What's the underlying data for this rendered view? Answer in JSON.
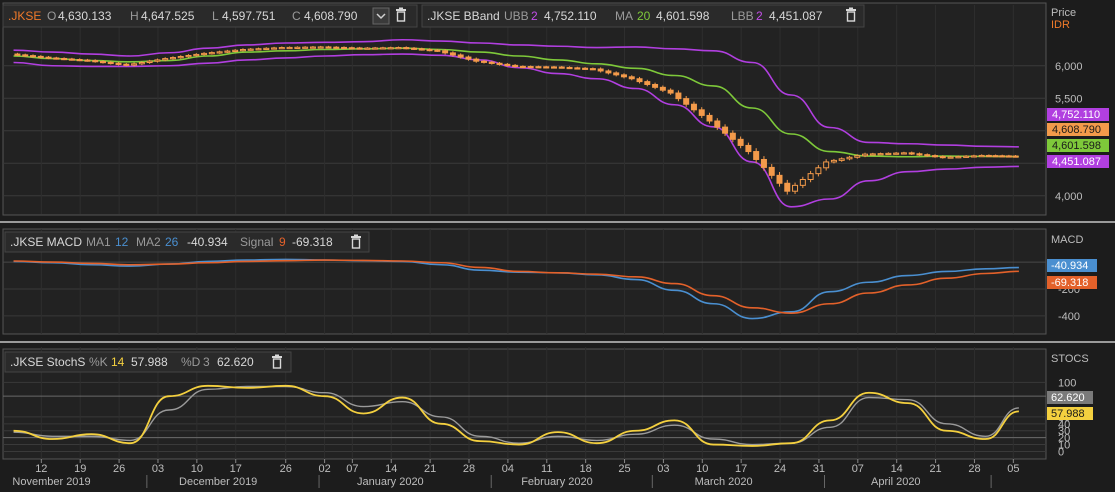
{
  "colors": {
    "background": "#1c1c1c",
    "panel": "#222222",
    "grid": "#3a3a3a",
    "candle": "#f39a4a",
    "bband_outer": "#b13fe0",
    "bband_ma": "#7ec93a",
    "macd_line": "#4a8fd0",
    "signal_line": "#e3612a",
    "stoch_k": "#f4d03f",
    "stoch_d": "#9a9a9a",
    "accent_orange": "#f07a2a"
  },
  "price_panel": {
    "legend": {
      "symbol": ".JKSE",
      "o_label": "O",
      "o_value": "4,630.133",
      "h_label": "H",
      "h_value": "4,647.525",
      "l_label": "L",
      "l_value": "4,597.751",
      "c_label": "C",
      "c_value": "4,608.790",
      "bband_name": ".JKSE BBand",
      "ubb_label": "UBB",
      "ubb_param": "2",
      "ubb_value": "4,752.110",
      "ma_label": "MA",
      "ma_param": "20",
      "ma_value": "4,601.598",
      "lbb_label": "LBB",
      "lbb_param": "2",
      "lbb_value": "4,451.087",
      "dropdown_icon": "chevron-down-icon",
      "delete_icon": "trash-icon"
    },
    "axis_title": "Price",
    "axis_unit": "IDR",
    "tags": {
      "ubb": "4,752.110",
      "close": "4,608.790",
      "ma": "4,601.598",
      "lbb": "4,451.087"
    }
  },
  "macd_panel": {
    "legend": {
      "name": ".JKSE MACD",
      "ma1_label": "MA1",
      "ma1_param": "12",
      "ma2_label": "MA2",
      "ma2_param": "26",
      "macd_value": "-40.934",
      "signal_label": "Signal",
      "signal_param": "9",
      "signal_value": "-69.318",
      "delete_icon": "trash-icon"
    },
    "axis_title": "MACD",
    "tags": {
      "macd": "-40.934",
      "signal": "-69.318"
    }
  },
  "stoch_panel": {
    "legend": {
      "name": ".JKSE StochS",
      "k_label": "%K",
      "k_param": "14",
      "k_value": "57.988",
      "d_label": "%D",
      "d_param": "3",
      "d_value": "62.620",
      "delete_icon": "trash-icon"
    },
    "axis_title": "STOCS",
    "tags": {
      "d": "62.620",
      "k": "57.988"
    }
  },
  "x_axis": {
    "day_ticks": [
      "12",
      "19",
      "26",
      "03",
      "10",
      "17",
      "26",
      "02",
      "07",
      "14",
      "21",
      "28",
      "04",
      "11",
      "18",
      "25",
      "03",
      "10",
      "17",
      "24",
      "31",
      "07",
      "14",
      "21",
      "28",
      "05"
    ],
    "months": [
      "November 2019",
      "December 2019",
      "January 2020",
      "February 2020",
      "March 2020",
      "April 2020"
    ]
  },
  "chart_data": [
    {
      "type": "candlestick",
      "title": ".JKSE",
      "ylabel": "Price IDR",
      "yticks": [
        4000,
        4500,
        5000,
        5500,
        6000
      ],
      "tick_labels": [
        "4,000",
        "",
        "",
        "5,500",
        "6,000"
      ],
      "ylim": [
        3750,
        6550
      ],
      "x": [
        "2019-11-07",
        "2019-11-14",
        "2019-11-21",
        "2019-11-28",
        "2019-12-05",
        "2019-12-12",
        "2019-12-19",
        "2019-12-26",
        "2020-01-02",
        "2020-01-09",
        "2020-01-16",
        "2020-01-23",
        "2020-01-30",
        "2020-02-06",
        "2020-02-13",
        "2020-02-20",
        "2020-02-27",
        "2020-03-05",
        "2020-03-12",
        "2020-03-19",
        "2020-03-26",
        "2020-04-02",
        "2020-04-09",
        "2020-04-16",
        "2020-04-23",
        "2020-04-30",
        "2020-05-06"
      ],
      "close": [
        6180,
        6120,
        6080,
        6010,
        6110,
        6190,
        6250,
        6280,
        6290,
        6270,
        6280,
        6230,
        6070,
        5990,
        5980,
        5950,
        5800,
        5580,
        5150,
        4680,
        4070,
        4520,
        4640,
        4660,
        4590,
        4620,
        4609
      ],
      "series": [
        {
          "name": "UBB",
          "values": [
            6240,
            6210,
            6180,
            6150,
            6200,
            6270,
            6320,
            6350,
            6360,
            6370,
            6400,
            6380,
            6350,
            6320,
            6300,
            6280,
            6290,
            6260,
            6230,
            6050,
            5550,
            5050,
            4820,
            4800,
            4780,
            4760,
            4752
          ]
        },
        {
          "name": "MA",
          "values": [
            6150,
            6110,
            6080,
            6060,
            6080,
            6150,
            6210,
            6230,
            6250,
            6260,
            6270,
            6250,
            6210,
            6150,
            6090,
            6030,
            5960,
            5850,
            5690,
            5350,
            4950,
            4680,
            4610,
            4600,
            4610,
            4605,
            4602
          ]
        },
        {
          "name": "LBB",
          "values": [
            6050,
            6000,
            5990,
            5990,
            6000,
            6040,
            6090,
            6120,
            6150,
            6170,
            6180,
            6160,
            6090,
            5970,
            5880,
            5800,
            5650,
            5400,
            5060,
            4520,
            3830,
            3950,
            4230,
            4370,
            4410,
            4440,
            4451
          ]
        }
      ]
    },
    {
      "type": "line",
      "title": ".JKSE MACD",
      "ylabel": "MACD",
      "yticks": [
        -200,
        -400
      ],
      "ylim": [
        -520,
        60
      ],
      "x": [
        "2019-11-07",
        "2019-11-14",
        "2019-11-21",
        "2019-11-28",
        "2019-12-05",
        "2019-12-12",
        "2019-12-19",
        "2019-12-26",
        "2020-01-02",
        "2020-01-09",
        "2020-01-16",
        "2020-01-23",
        "2020-01-30",
        "2020-02-06",
        "2020-02-13",
        "2020-02-20",
        "2020-02-27",
        "2020-03-05",
        "2020-03-12",
        "2020-03-19",
        "2020-03-26",
        "2020-04-02",
        "2020-04-09",
        "2020-04-16",
        "2020-04-23",
        "2020-04-30",
        "2020-05-06"
      ],
      "series": [
        {
          "name": "MACD",
          "values": [
            5,
            -5,
            -20,
            -30,
            -15,
            5,
            15,
            20,
            15,
            10,
            5,
            -20,
            -60,
            -75,
            -80,
            -95,
            -130,
            -210,
            -310,
            -420,
            -370,
            -220,
            -150,
            -100,
            -70,
            -50,
            -41
          ]
        },
        {
          "name": "Signal",
          "values": [
            8,
            0,
            -10,
            -20,
            -15,
            -5,
            5,
            10,
            15,
            12,
            8,
            -5,
            -40,
            -70,
            -80,
            -90,
            -110,
            -160,
            -250,
            -340,
            -380,
            -310,
            -230,
            -170,
            -120,
            -85,
            -69
          ]
        }
      ]
    },
    {
      "type": "line",
      "title": ".JKSE StochS",
      "ylabel": "STOCS",
      "yticks": [
        0,
        10,
        20,
        30,
        40,
        50,
        100
      ],
      "ylim": [
        -8,
        115
      ],
      "x": [
        "2019-11-07",
        "2019-11-14",
        "2019-11-21",
        "2019-11-28",
        "2019-12-05",
        "2019-12-12",
        "2019-12-19",
        "2019-12-26",
        "2020-01-02",
        "2020-01-09",
        "2020-01-16",
        "2020-01-23",
        "2020-01-30",
        "2020-02-06",
        "2020-02-13",
        "2020-02-20",
        "2020-02-27",
        "2020-03-05",
        "2020-03-12",
        "2020-03-19",
        "2020-03-26",
        "2020-04-02",
        "2020-04-09",
        "2020-04-16",
        "2020-04-23",
        "2020-04-30",
        "2020-05-06"
      ],
      "series": [
        {
          "name": "%K",
          "values": [
            30,
            18,
            25,
            12,
            80,
            95,
            92,
            95,
            80,
            55,
            78,
            40,
            15,
            10,
            28,
            12,
            30,
            45,
            10,
            8,
            12,
            45,
            85,
            70,
            30,
            18,
            58
          ]
        },
        {
          "name": "%D",
          "values": [
            28,
            22,
            22,
            16,
            60,
            90,
            94,
            94,
            85,
            65,
            72,
            50,
            22,
            12,
            22,
            16,
            25,
            38,
            18,
            10,
            12,
            35,
            78,
            75,
            40,
            22,
            63
          ]
        }
      ]
    }
  ]
}
